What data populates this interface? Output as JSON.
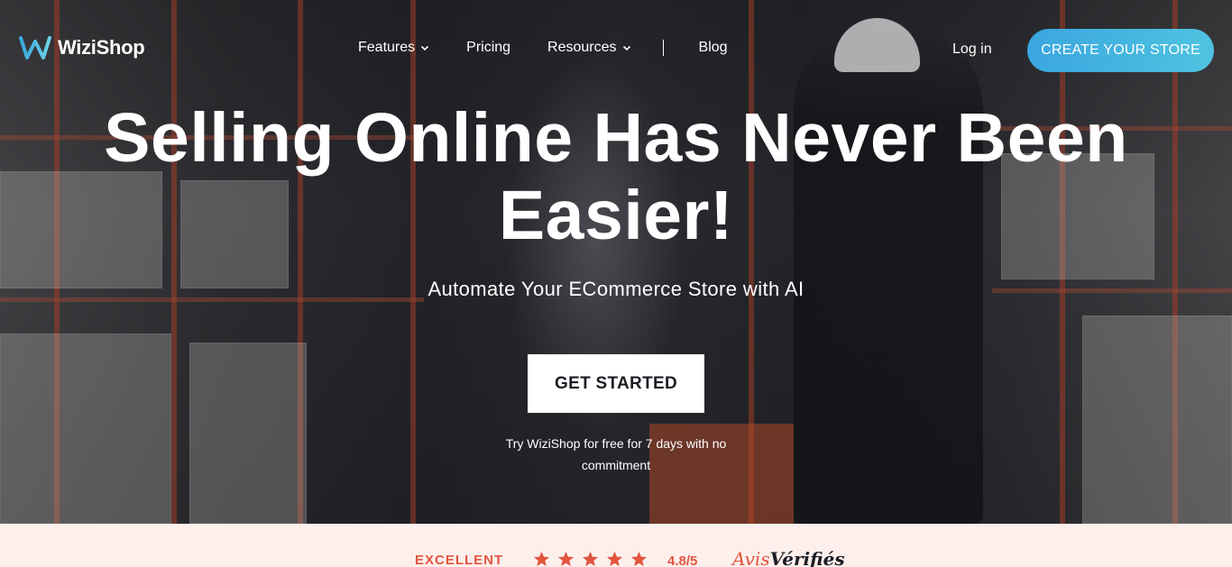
{
  "brand": {
    "name": "WiziShop",
    "logo_icon": "wizishop-w-logo-icon",
    "accent": "#3aa6e0"
  },
  "nav": {
    "items": [
      {
        "label": "Features",
        "has_dropdown": true
      },
      {
        "label": "Pricing",
        "has_dropdown": false
      },
      {
        "label": "Resources",
        "has_dropdown": true
      },
      {
        "label": "Blog",
        "has_dropdown": false
      }
    ],
    "login": "Log in",
    "cta": "CREATE YOUR STORE"
  },
  "hero": {
    "headline_line1": "Selling Online Has Never Been",
    "headline_line2": "Easier!",
    "subheadline": "Automate Your ECommerce Store with AI",
    "cta": "GET STARTED",
    "trial_line1": "Try WiziShop for free for 7 days with no",
    "trial_line2": "commitment"
  },
  "rating": {
    "label": "EXCELLENT",
    "stars": 5,
    "score": "4.8/5",
    "provider_part1": "Avis",
    "provider_part2": "Vérifiés",
    "color": "#e2553f"
  }
}
